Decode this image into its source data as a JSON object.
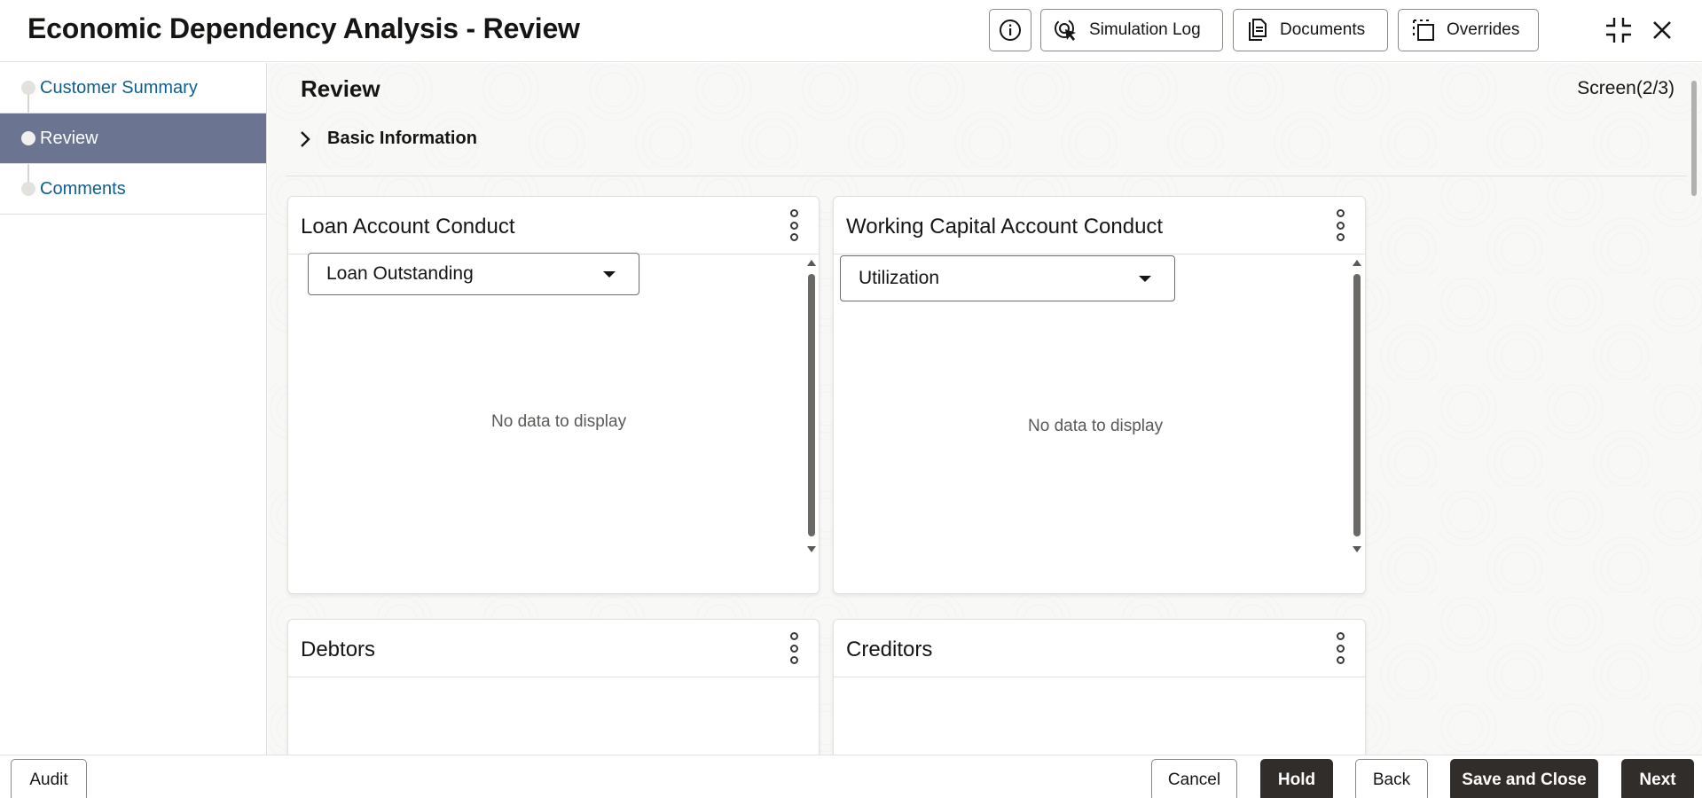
{
  "header": {
    "title": "Economic Dependency Analysis - Review",
    "buttons": {
      "simulation_log": "Simulation Log",
      "documents": "Documents",
      "overrides": "Overrides"
    }
  },
  "sidebar": {
    "items": [
      {
        "label": "Customer Summary",
        "active": false
      },
      {
        "label": "Review",
        "active": true
      },
      {
        "label": "Comments",
        "active": false
      }
    ]
  },
  "main": {
    "page_title": "Review",
    "screen_indicator": "Screen(2/3)",
    "basic_info_label": "Basic Information",
    "cards": {
      "loan": {
        "title": "Loan Account Conduct",
        "select_value": "Loan Outstanding",
        "empty_text": "No data to display"
      },
      "working_capital": {
        "title": "Working Capital Account Conduct",
        "select_value": "Utilization",
        "empty_text": "No data to display"
      },
      "debtors": {
        "title": "Debtors"
      },
      "creditors": {
        "title": "Creditors"
      }
    }
  },
  "footer": {
    "audit": "Audit",
    "cancel": "Cancel",
    "hold": "Hold",
    "back": "Back",
    "save_close": "Save and Close",
    "next": "Next"
  },
  "colors": {
    "sidebar_active_bg": "#6b7491",
    "link_blue": "#0e5f8f",
    "dark_button": "#312d2a"
  }
}
